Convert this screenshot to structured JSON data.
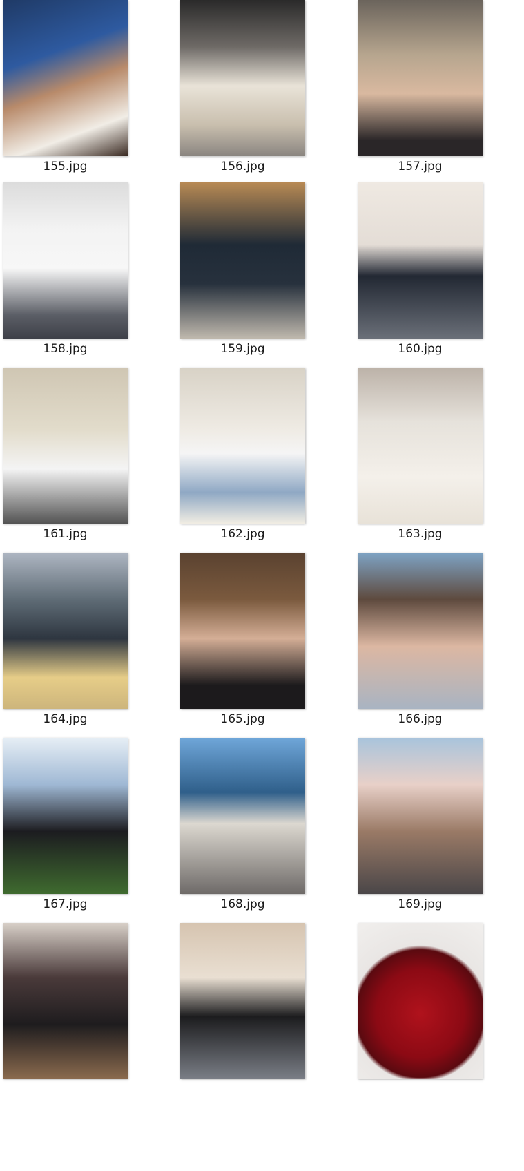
{
  "files": [
    {
      "name": "155.jpg",
      "bg": "linear-gradient(160deg,#1f3a66 0%,#2e5aa0 35%,#b88a6a 55%,#f1ede6 80%,#3a2a22 100%)"
    },
    {
      "name": "156.jpg",
      "bg": "linear-gradient(180deg,#2a2a2a 0%,#6e6a66 30%,#e9e3d8 55%,#c9bfae 80%,#8a8580 100%)"
    },
    {
      "name": "157.jpg",
      "bg": "linear-gradient(180deg,#6b645c 0%,#b6a58e 35%,#d9b9a0 60%,#2a2628 90%)"
    },
    {
      "name": "158.jpg",
      "bg": "linear-gradient(180deg,#dcdcdc 0%,#f3f3f3 30%,#f7f7f7 55%,#5b5e66 85%,#3e4048 100%)"
    },
    {
      "name": "159.jpg",
      "bg": "linear-gradient(180deg,#b88a54 0%,#1f2a36 40%,#27313d 65%,#bfb8ad 100%)"
    },
    {
      "name": "160.jpg",
      "bg": "linear-gradient(180deg,#efe9e2 0%,#e4ddd6 40%,#222833 60%,#6a6f78 100%)"
    },
    {
      "name": "161.jpg",
      "bg": "linear-gradient(180deg,#cfc6b3 0%,#e2dccb 40%,#f4f4f4 65%,#535353 100%)"
    },
    {
      "name": "162.jpg",
      "bg": "linear-gradient(180deg,#d8d2c6 0%,#efebe4 40%,#f5f5f5 55%,#8fa8c4 80%,#f1ede3 100%)"
    },
    {
      "name": "163.jpg",
      "bg": "linear-gradient(180deg,#bcb2a8 0%,#e6e2db 35%,#f4f0ea 70%,#e8e2d8 100%)"
    },
    {
      "name": "164.jpg",
      "bg": "linear-gradient(180deg,#aeb6c2 0%,#5f6c76 30%,#2e3640 55%,#e6cd88 80%,#cdb57c 100%)"
    },
    {
      "name": "165.jpg",
      "bg": "linear-gradient(180deg,#5a4230 0%,#7b5a3e 30%,#d4ae96 55%,#1c1a1c 85%)"
    },
    {
      "name": "166.jpg",
      "bg": "linear-gradient(180deg,#7ea3c4 0%,#5e4a3e 30%,#dcb7a2 60%,#a9b4c2 100%)"
    },
    {
      "name": "167.jpg",
      "bg": "linear-gradient(180deg,#e6eef5 0%,#9fb8d4 30%,#1c1c20 60%,#3f6b2f 100%)"
    },
    {
      "name": "168.jpg",
      "bg": "linear-gradient(180deg,#6fa6d9 0%,#2f5f8a 35%,#dcd8d0 55%,#6e6a68 100%)"
    },
    {
      "name": "169.jpg",
      "bg": "linear-gradient(180deg,#a9c4dc 0%,#e8d0c8 30%,#9a7a66 60%,#4a4648 100%)"
    },
    {
      "name": "",
      "bg": "linear-gradient(180deg,#d8d0c8 0%,#4a3a3a 35%,#1e1c1e 65%,#8a6a4e 100%)"
    },
    {
      "name": "",
      "bg": "linear-gradient(180deg,#d6c4b0 0%,#e9dfd2 35%,#1c1c1e 60%,#7a7e86 100%)"
    },
    {
      "name": "",
      "bg": "radial-gradient(circle at 50% 58%,#b0121c 0%,#8c0a14 40%,#5a0a10 58%,#e9e6e4 62%,#f1efed 100%)"
    }
  ]
}
